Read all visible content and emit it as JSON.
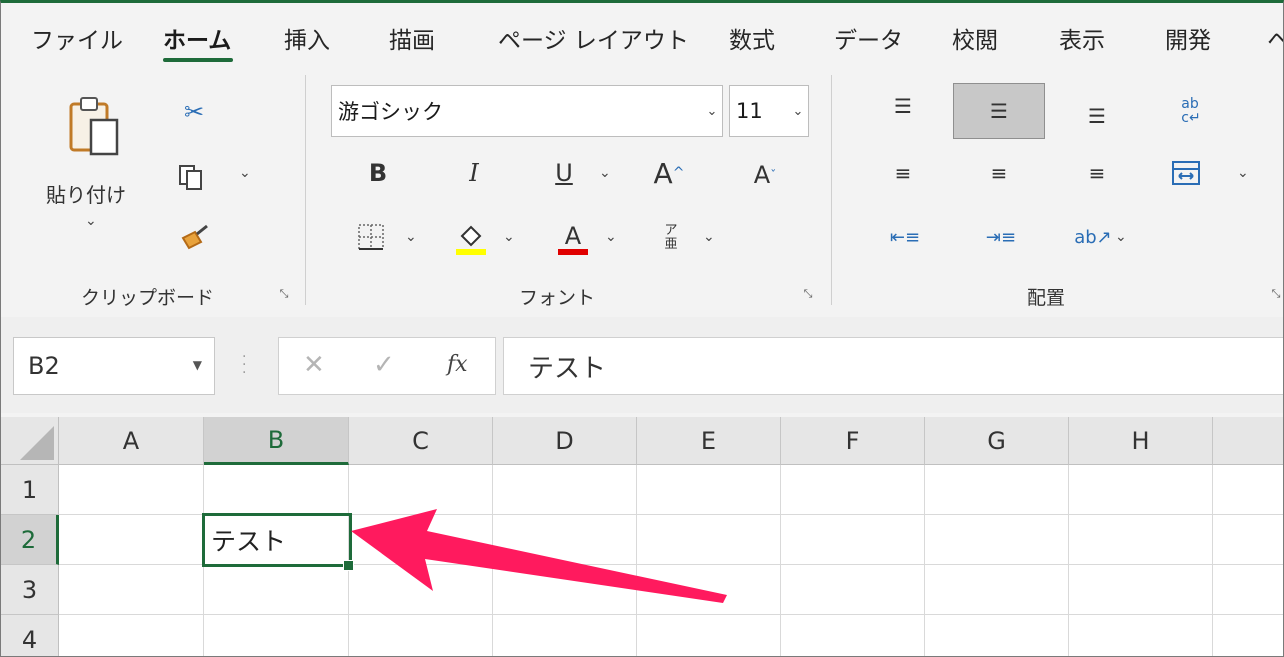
{
  "tabs": [
    "ファイル",
    "ホーム",
    "挿入",
    "描画",
    "ページ レイアウト",
    "数式",
    "データ",
    "校閲",
    "表示",
    "開発",
    "ヘ"
  ],
  "ribbon": {
    "clipboard": {
      "paste_label": "貼り付け",
      "group_label": "クリップボード"
    },
    "font": {
      "font_name": "游ゴシック",
      "font_size": "11",
      "group_label": "フォント",
      "bold": "B",
      "italic": "I",
      "underline": "U"
    },
    "alignment": {
      "group_label": "配置"
    }
  },
  "formula_bar": {
    "name_box": "B2",
    "formula": "テスト",
    "fx": "fx"
  },
  "grid": {
    "columns": [
      "A",
      "B",
      "C",
      "D",
      "E",
      "F",
      "G",
      "H"
    ],
    "rows": [
      "1",
      "2",
      "3",
      "4"
    ],
    "active_cell": {
      "ref": "B2",
      "value": "テスト"
    }
  },
  "colors": {
    "accent": "#1e6b3a",
    "annotation_arrow": "#ff1a5e",
    "highlight": "#ffff00",
    "font_color": "#e00000"
  }
}
